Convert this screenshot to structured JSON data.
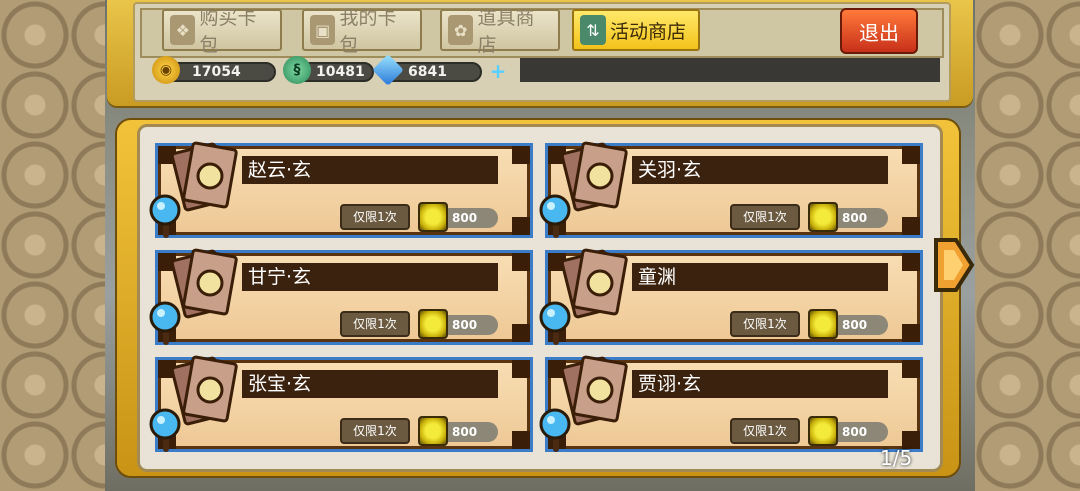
{
  "tabs": [
    {
      "label": "购买卡包",
      "icon": "card-pack-icon",
      "active": false
    },
    {
      "label": "我的卡包",
      "icon": "my-cards-icon",
      "active": false
    },
    {
      "label": "道具商店",
      "icon": "item-shop-icon",
      "active": false
    },
    {
      "label": "活动商店",
      "icon": "event-shop-icon",
      "active": true
    }
  ],
  "exit_label": "退出",
  "currency": {
    "gold": "17054",
    "jade": "10481",
    "diamond": "6841"
  },
  "cards": [
    {
      "name": "赵云·玄",
      "limit": "仅限1次",
      "price": "800"
    },
    {
      "name": "关羽·玄",
      "limit": "仅限1次",
      "price": "800"
    },
    {
      "name": "甘宁·玄",
      "limit": "仅限1次",
      "price": "800"
    },
    {
      "name": "童渊",
      "limit": "仅限1次",
      "price": "800"
    },
    {
      "name": "张宝·玄",
      "limit": "仅限1次",
      "price": "800"
    },
    {
      "name": "贾诩·玄",
      "limit": "仅限1次",
      "price": "800"
    }
  ],
  "pagination": "1/5",
  "colors": {
    "accent": "#f3c21a",
    "card_border": "#3b7cc8",
    "exit": "#c8301a"
  }
}
